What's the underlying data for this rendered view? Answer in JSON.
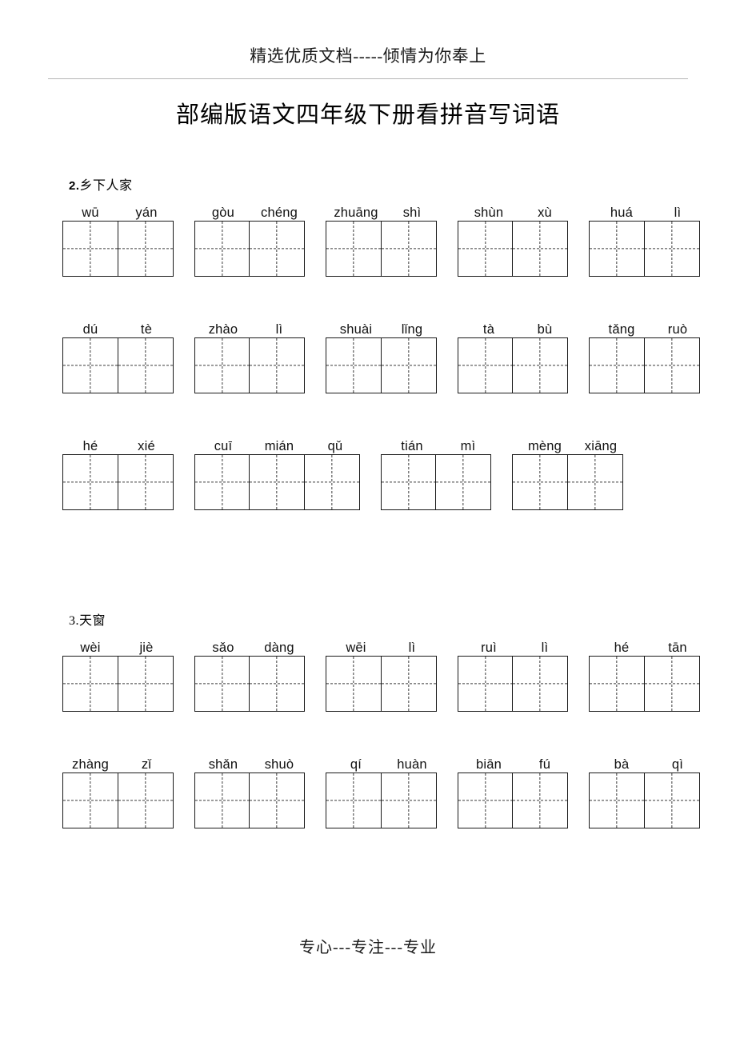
{
  "header": {
    "watermark_text": "精选优质文档-----倾情为你奉上"
  },
  "title": "部编版语文四年级下册看拼音写词语",
  "footer": {
    "text": "专心---专注---专业"
  },
  "sections": [
    {
      "number": "2.",
      "name": "乡下人家",
      "bold_number": true,
      "rows": [
        {
          "groups": [
            {
              "syllables": [
                "wū",
                "yán"
              ],
              "cells": 2,
              "widths": [
                70,
                70
              ]
            },
            {
              "syllables": [
                "gòu",
                "chéng"
              ],
              "cells": 2,
              "widths": [
                70,
                70
              ]
            },
            {
              "syllables": [
                "zhuāng",
                "shì"
              ],
              "cells": 2,
              "widths": [
                70,
                70
              ]
            },
            {
              "syllables": [
                "shùn",
                "xù"
              ],
              "cells": 2,
              "widths": [
                70,
                70
              ]
            },
            {
              "syllables": [
                "huá",
                "lì"
              ],
              "cells": 2,
              "widths": [
                70,
                70
              ]
            }
          ]
        },
        {
          "groups": [
            {
              "syllables": [
                "dú",
                "tè"
              ],
              "cells": 2,
              "widths": [
                70,
                70
              ]
            },
            {
              "syllables": [
                "zhào",
                "lì"
              ],
              "cells": 2,
              "widths": [
                70,
                70
              ]
            },
            {
              "syllables": [
                "shuài",
                "lǐng"
              ],
              "cells": 2,
              "widths": [
                70,
                70
              ]
            },
            {
              "syllables": [
                "tà",
                "bù"
              ],
              "cells": 2,
              "widths": [
                70,
                70
              ]
            },
            {
              "syllables": [
                "tǎng",
                "ruò"
              ],
              "cells": 2,
              "widths": [
                70,
                70
              ]
            }
          ]
        },
        {
          "groups": [
            {
              "syllables": [
                "hé",
                "xié"
              ],
              "cells": 2,
              "widths": [
                70,
                70
              ]
            },
            {
              "syllables": [
                "cuī",
                "mián",
                "qǔ"
              ],
              "cells": 3,
              "widths": [
                70,
                70,
                70
              ]
            },
            {
              "syllables": [
                "tián",
                "mì"
              ],
              "cells": 2,
              "widths": [
                70,
                70
              ]
            },
            {
              "syllables": [
                "mèng",
                "xiāng"
              ],
              "cells": 2,
              "widths": [
                70,
                70
              ]
            }
          ]
        }
      ]
    },
    {
      "number": "3.",
      "name": "天窗",
      "bold_number": false,
      "rows": [
        {
          "groups": [
            {
              "syllables": [
                "wèi",
                "jiè"
              ],
              "cells": 2,
              "widths": [
                70,
                70
              ]
            },
            {
              "syllables": [
                "sǎo",
                "dàng"
              ],
              "cells": 2,
              "widths": [
                70,
                70
              ]
            },
            {
              "syllables": [
                "wēi",
                "lì"
              ],
              "cells": 2,
              "widths": [
                70,
                70
              ]
            },
            {
              "syllables": [
                "ruì",
                "lì"
              ],
              "cells": 2,
              "widths": [
                70,
                70
              ]
            },
            {
              "syllables": [
                "hé",
                "tān"
              ],
              "cells": 2,
              "widths": [
                70,
                70
              ]
            }
          ]
        },
        {
          "groups": [
            {
              "syllables": [
                "zhàng",
                "zǐ"
              ],
              "cells": 2,
              "widths": [
                70,
                70
              ]
            },
            {
              "syllables": [
                "shǎn",
                "shuò"
              ],
              "cells": 2,
              "widths": [
                70,
                70
              ]
            },
            {
              "syllables": [
                "qí",
                "huàn"
              ],
              "cells": 2,
              "widths": [
                70,
                70
              ]
            },
            {
              "syllables": [
                "biān",
                "fú"
              ],
              "cells": 2,
              "widths": [
                70,
                70
              ]
            },
            {
              "syllables": [
                "bà",
                "qì"
              ],
              "cells": 2,
              "widths": [
                70,
                70
              ]
            }
          ]
        }
      ]
    }
  ],
  "layout": {
    "section_tops": [
      218,
      762
    ],
    "row_offsets": [
      48,
      208,
      368
    ],
    "section3_row_offsets": [
      48,
      208
    ]
  }
}
